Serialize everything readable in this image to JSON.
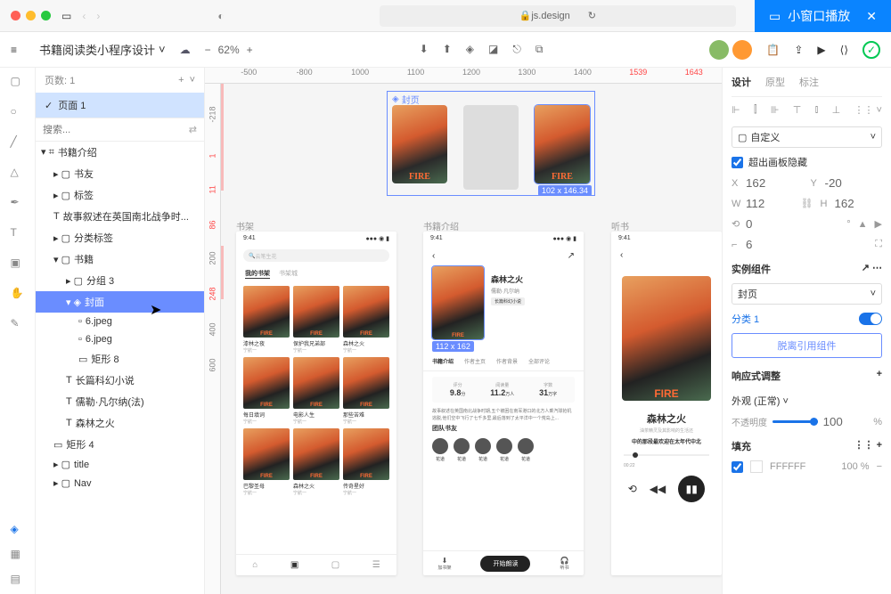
{
  "browser": {
    "url": "js.design",
    "small_window": "小窗口播放"
  },
  "toolbar": {
    "project": "书籍阅读类小程序设计",
    "zoom": "62%"
  },
  "layers_panel": {
    "pages_label": "页数: 1",
    "page1": "页面 1",
    "search_placeholder": "搜索...",
    "group_intro": "书籍介绍",
    "folder_friends": "书友",
    "folder_tags": "标签",
    "text_story": "故事叙述在英国南北战争时...",
    "folder_cat_tags": "分类标签",
    "folder_books": "书籍",
    "group3": "分组 3",
    "cover_layer": "封面",
    "img6": "6.jpeg",
    "img6b": "6.jpeg",
    "rect8": "矩形 8",
    "text_scifi": "长篇科幻小说",
    "text_verne": "儒勒·凡尔纳(法)",
    "text_forest": "森林之火",
    "rect4": "矩形 4",
    "folder_title": "title",
    "folder_nav": "Nav"
  },
  "canvas": {
    "ruler_marks": [
      "-500",
      "-800",
      "1000",
      "1100",
      "1200",
      "1300",
      "1400",
      "1539",
      "1643"
    ],
    "v_marks": [
      "-218",
      "1",
      "11",
      "86",
      "200",
      "248",
      "400",
      "600"
    ],
    "group_label": "封页",
    "thumb_badge": "102 x 146.34",
    "frame_bookshelf": "书架",
    "frame_intro": "书籍介绍",
    "frame_listen": "听书",
    "detail_badge": "112 x 162"
  },
  "phone": {
    "time": "9:41",
    "search_ph": "云笔生花",
    "tab_my": "我的书架",
    "tab_city": "书架城",
    "books": [
      {
        "t": "漆林之夜",
        "s": "宁航一"
      },
      {
        "t": "保护我兄弟部",
        "s": "宁航一"
      },
      {
        "t": "森林之火",
        "s": "宁航一"
      },
      {
        "t": "每日填词",
        "s": "宁航一"
      },
      {
        "t": "电影人生",
        "s": "宁航一"
      },
      {
        "t": "那些苦难",
        "s": "宁航一"
      },
      {
        "t": "巴黎圣母",
        "s": "宁航一"
      },
      {
        "t": "森林之火",
        "s": "宁航一"
      },
      {
        "t": "传奇星好",
        "s": "宁航一"
      }
    ]
  },
  "detail": {
    "title": "森林之火",
    "author": "儒勒·凡尔纳",
    "tag": "长篇科幻小说",
    "tabs": [
      "书籍介绍",
      "作者主页",
      "作者背景",
      "全部评论"
    ],
    "stat1_l": "评分",
    "stat1_n": "9.8",
    "stat1_u": "分",
    "stat2_l": "阅读量",
    "stat2_n": "11.2",
    "stat2_u": "万人",
    "stat3_l": "字数",
    "stat3_n": "31",
    "stat3_u": "万字",
    "desc": "故事叙述在英国南北战争时期,五个被困在南军港口的北方人乘汽球抢机逃脱,他们空中飞行了七千多里,最后落到了太平洋中一个荒岛上...",
    "friends_label": "团队书友",
    "friends": [
      "花道",
      "花道",
      "花道",
      "花道",
      "花道"
    ],
    "btn_add": "加书架",
    "btn_read": "开始朗读",
    "btn_listen": "听书"
  },
  "listen": {
    "title": "森林之火",
    "sub1": "油茶精灵及其影响的生活还",
    "sub2": "中的那段最欢迎在太年代中北"
  },
  "rpanel": {
    "tabs": [
      "设计",
      "原型",
      "标注"
    ],
    "custom": "自定义",
    "overflow": "超出画板隐藏",
    "x": "162",
    "y": "-20",
    "w": "112",
    "h": "162",
    "rotation": "0",
    "radius": "6",
    "instance": "实例组件",
    "comp_name": "封页",
    "variant_label": "分类 1",
    "detach": "脱离引用组件",
    "responsive": "响应式调整",
    "appearance": "外观 (正常)",
    "opacity_label": "不透明度",
    "opacity_val": "100",
    "fill": "填充",
    "fill_color": "FFFFFF",
    "fill_pct": "100"
  }
}
